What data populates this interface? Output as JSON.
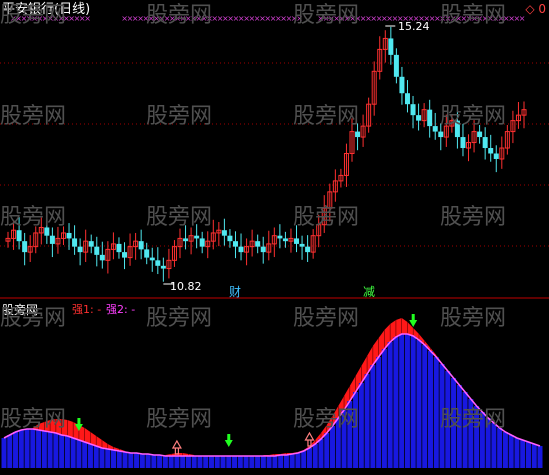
{
  "header": {
    "title": "平安银行(日线)",
    "title_color": "#ffffff",
    "right_marker": "◇ 0",
    "right_marker_color": "#ff4040"
  },
  "watermark": {
    "text": "股旁网",
    "color": "#5a5a5a"
  },
  "main_panel": {
    "high_label": "15.24",
    "low_label": "10.82",
    "tag_cai": "财",
    "tag_cai_color": "#40c0ff",
    "tag_jian": "减",
    "tag_jian_color": "#40ff40",
    "cross_marker_color": "#d040d0",
    "up_color": "#ff3030",
    "down_color": "#50e8f0",
    "grid_color": "#a00000"
  },
  "indicator_panel": {
    "label": "股旁网",
    "legend_1": "强1: -",
    "legend_1_color": "#ff3030",
    "legend_2": "强2: -",
    "legend_2_color": "#ff40ff",
    "bar_color": "#1818e0",
    "fill_color": "#ff1818",
    "line_color": "#ff60ff",
    "buy_arrow_color": "#ff8080",
    "sell_arrow_color": "#20ff20"
  },
  "chart_data": [
    {
      "type": "candlestick",
      "title": "平安银行(日线)",
      "annotations": [
        "15.24",
        "10.82",
        "财",
        "减"
      ],
      "price_range": [
        10.6,
        15.4
      ],
      "high_value": 15.24,
      "low_value": 10.82,
      "closes": [
        11.45,
        11.6,
        11.4,
        11.2,
        11.3,
        11.55,
        11.65,
        11.5,
        11.35,
        11.45,
        11.55,
        11.45,
        11.3,
        11.2,
        11.4,
        11.3,
        11.15,
        11.05,
        11.25,
        11.35,
        11.2,
        11.1,
        11.3,
        11.4,
        11.25,
        11.1,
        11.05,
        10.95,
        10.9,
        11.05,
        11.3,
        11.45,
        11.4,
        11.5,
        11.45,
        11.3,
        11.4,
        11.55,
        11.6,
        11.5,
        11.4,
        11.3,
        11.2,
        11.3,
        11.4,
        11.3,
        11.2,
        11.35,
        11.5,
        11.45,
        11.4,
        11.45,
        11.35,
        11.3,
        11.2,
        11.5,
        11.7,
        12.0,
        12.3,
        12.5,
        12.6,
        13.0,
        13.4,
        13.3,
        13.5,
        13.9,
        14.5,
        14.9,
        15.1,
        14.8,
        14.4,
        14.1,
        13.9,
        13.7,
        13.6,
        13.8,
        13.5,
        13.4,
        13.3,
        13.5,
        13.6,
        13.3,
        13.1,
        13.2,
        13.4,
        13.3,
        13.1,
        13.0,
        12.9,
        13.1,
        13.4,
        13.6,
        13.7,
        13.8
      ],
      "cross_markers_top": true
    },
    {
      "type": "bar",
      "title": "",
      "series": [
        {
          "name": "强1",
          "values": [
            22,
            27,
            30,
            33,
            37,
            40,
            44,
            46,
            48,
            49,
            49,
            48,
            46,
            43,
            40,
            36,
            32,
            28,
            24,
            21,
            19,
            17,
            15,
            13,
            12,
            11,
            11,
            12,
            13,
            14,
            15,
            15,
            14,
            13,
            12,
            11,
            10,
            10,
            10,
            10,
            10,
            10,
            11,
            12,
            12,
            13,
            13,
            14,
            14,
            15,
            15,
            16,
            18,
            22,
            28,
            35,
            43,
            52,
            62,
            72,
            82,
            92,
            102,
            112,
            122,
            130,
            138,
            144,
            148,
            150,
            146,
            140,
            134,
            127,
            120,
            113,
            105,
            98,
            90,
            82,
            75,
            68,
            61,
            55,
            49,
            44,
            40,
            36,
            33,
            30,
            28,
            26,
            24,
            22
          ]
        },
        {
          "name": "强2",
          "values": [
            30,
            33,
            36,
            38,
            39,
            39,
            38,
            37,
            36,
            35,
            33,
            32,
            30,
            28,
            26,
            24,
            22,
            20,
            19,
            18,
            17,
            16,
            15,
            15,
            14,
            14,
            13,
            13,
            12,
            12,
            12,
            12,
            12,
            12,
            12,
            12,
            12,
            12,
            12,
            12,
            12,
            12,
            12,
            12,
            12,
            12,
            12,
            12,
            13,
            13,
            14,
            15,
            17,
            20,
            24,
            29,
            35,
            42,
            50,
            58,
            67,
            76,
            85,
            94,
            103,
            111,
            119,
            126,
            131,
            134,
            134,
            132,
            128,
            123,
            117,
            111,
            104,
            97,
            90,
            83,
            76,
            69,
            62,
            56,
            50,
            45,
            40,
            36,
            33,
            30,
            28,
            26,
            24,
            22
          ]
        }
      ],
      "buy_signals": [
        30,
        53
      ],
      "sell_signals": [
        13,
        39,
        71
      ]
    }
  ]
}
